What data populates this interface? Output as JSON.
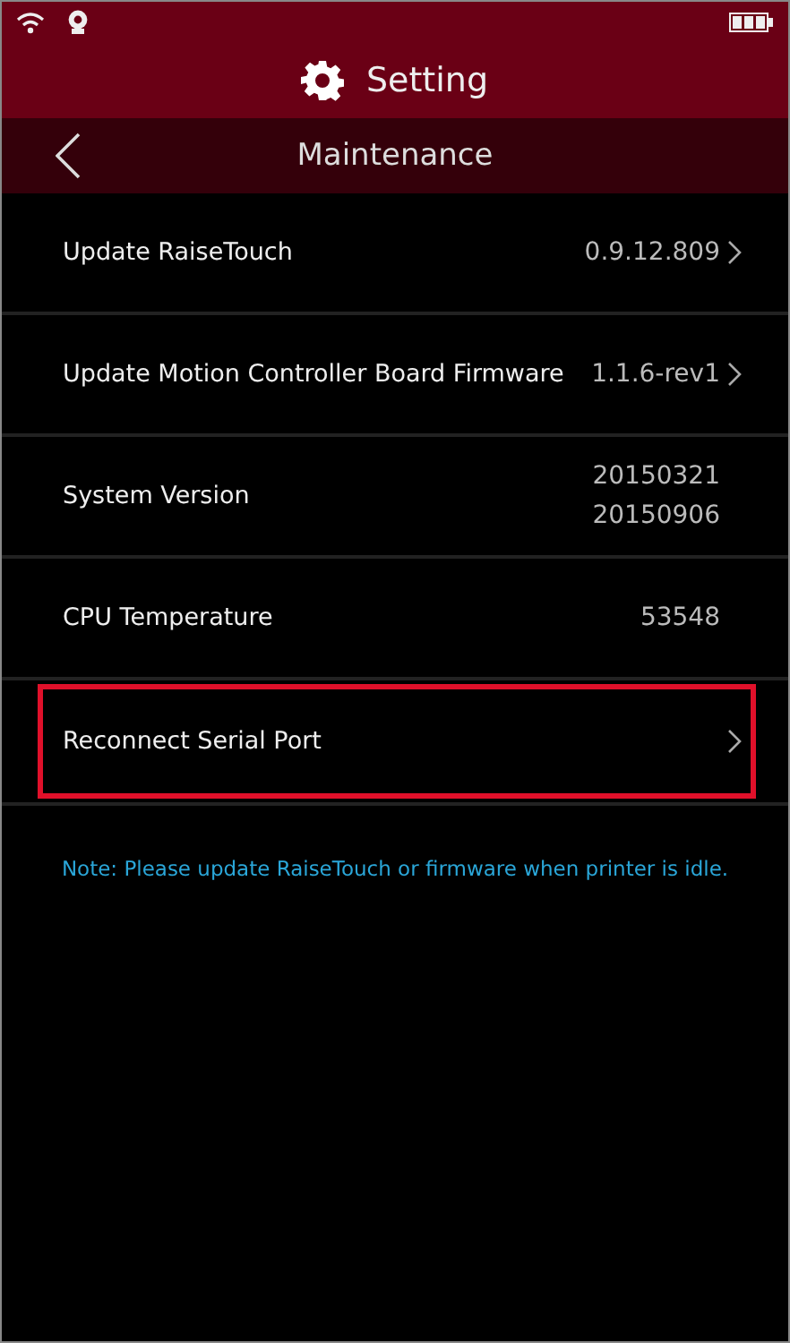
{
  "header": {
    "title": "Setting"
  },
  "subheader": {
    "title": "Maintenance"
  },
  "rows": [
    {
      "kind": "link",
      "label": "Update RaiseTouch",
      "values": [
        "0.9.12.809"
      ],
      "highlighted": false
    },
    {
      "kind": "link",
      "label": "Update Motion Controller Board Firmware",
      "values": [
        "1.1.6-rev1"
      ],
      "highlighted": false
    },
    {
      "kind": "info",
      "label": "System Version",
      "values": [
        "20150321",
        "20150906"
      ],
      "highlighted": false
    },
    {
      "kind": "info",
      "label": "CPU Temperature",
      "values": [
        "53548"
      ],
      "highlighted": false
    },
    {
      "kind": "link",
      "label": "Reconnect Serial Port",
      "values": [],
      "highlighted": true
    }
  ],
  "note": "Note: Please update RaiseTouch or firmware when printer is idle."
}
